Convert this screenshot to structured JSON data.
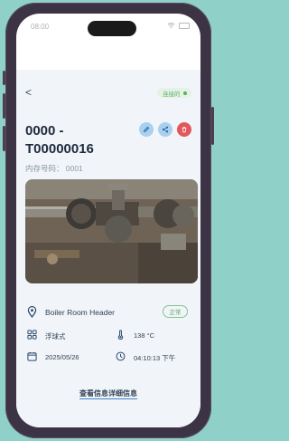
{
  "status_bar": {
    "time": "08:00"
  },
  "header": {
    "back_label": "<",
    "connection_status": "连接的"
  },
  "device": {
    "title": "0000 -\nT00000016",
    "inventory": "内存号码： 0001",
    "name": "Boiler Room Header",
    "status": "正常",
    "type": "浮球式",
    "temperature": "138 °C",
    "date": "2025/05/26",
    "time": "04:10:13 下午"
  },
  "link": {
    "label": "查看信息详细信息"
  },
  "colors": {
    "accent": "#3b82c4",
    "ok_green": "#56b15f",
    "danger": "#e2575c"
  },
  "icons": [
    "edit-icon",
    "share-icon",
    "trash-icon",
    "location-pin-icon",
    "grid-icon",
    "thermometer-icon",
    "calendar-icon",
    "clock-icon"
  ]
}
